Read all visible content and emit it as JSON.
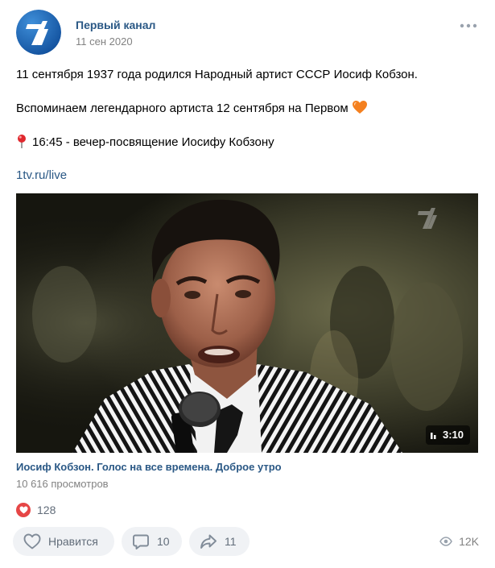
{
  "post": {
    "author": "Первый канал",
    "date": "11 сен 2020",
    "lines": [
      "11 сентября 1937 года родился Народный артист СССР Иосиф Кобзон.",
      "Вспоминаем легендарного артиста 12 сентября на Первом",
      "16:45 - вечер-посвящение Иосифу Кобзону"
    ],
    "link": "1tv.ru/live"
  },
  "icons": {
    "pin": "round-pushpin-icon",
    "heart_emoji": "orange-heart-icon",
    "more": "more-dots-icon",
    "like": "heart-outline-icon",
    "comment": "comment-bubble-icon",
    "share": "share-arrow-icon",
    "views": "eye-icon"
  },
  "video": {
    "title": "Иосиф Кобзон. Голос на все времена. Доброе утро",
    "views": "10 616 просмотров",
    "duration": "3:10"
  },
  "reactions": {
    "count": "128"
  },
  "actions": {
    "like_label": "Нравится",
    "comments": "10",
    "shares": "11",
    "views": "12K"
  },
  "colors": {
    "link": "#2a5885",
    "muted": "#828282",
    "button_bg": "#f0f2f5",
    "button_text": "#626d7a",
    "reaction": "#e64646",
    "brand_blue": "#1565c0"
  }
}
